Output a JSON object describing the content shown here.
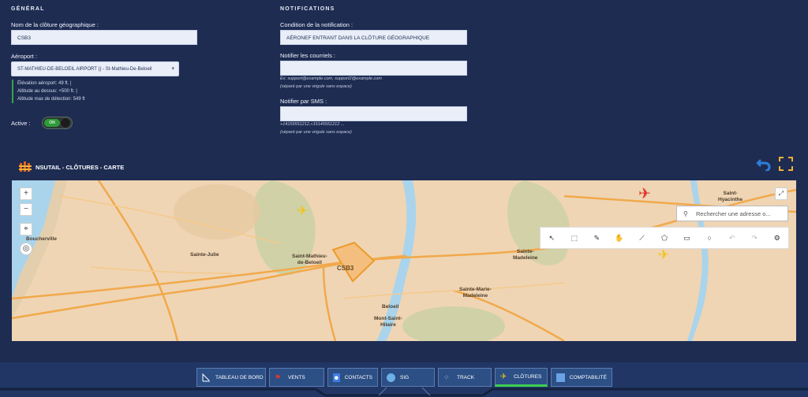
{
  "general": {
    "title": "GÉNÉRAL",
    "name_label": "Nom de la clôture géographique :",
    "name_value": "CSB3",
    "airport_label": "Aéroport :",
    "airport_value": "ST-MATHIEU-DE-BELOEIL AIRPORT () - St-Mathieu-De-Beloeil",
    "elevation": "Élévation aéroport: 49 ft. |",
    "altitude_above": "Altitude au dessus: +500 ft. |",
    "altitude_max": "Altitude max de détection: 549 ft",
    "active_label": "Active :",
    "toggle_on": "ON"
  },
  "notifications": {
    "title": "NOTIFICATIONS",
    "condition_label": "Condition de la notification :",
    "condition_value": "AÉRONEF ENTRANT DANS LA CLÔTURE GÉOGRAPHIQUE",
    "email_label": "Notifier les courriels :",
    "email_hint1": "Ex: support@example.com, support2@example.com",
    "email_hint2": "(séparé par une virgule sans espace)",
    "sms_label": "Notifier par SMS :",
    "sms_hint1": "+14155551212,+15145551212 ...",
    "sms_hint2": "(séparé par une virgule sans espace)"
  },
  "map_header": {
    "title": "NSUTAIL - CLÔTURES - CARTE"
  },
  "map": {
    "search_placeholder": "Rechercher une adresse o...",
    "fence_label": "CSB3",
    "places": {
      "saint_julie": "Sainte-Julie",
      "saint_mathieu": "Saint-Mathieu-\nde-Beloeil",
      "beloeil": "Beloeil",
      "mont_saint_hilaire": "Mont-Saint-\nHilaire",
      "sainte_marie": "Sainte-Marie-\nMadeleine",
      "sainte_madeleine": "Sainte-\nMadeleine",
      "saint_hyacinthe": "Saint-\nHyacinthe",
      "boucherville": "Boucherville"
    }
  },
  "nav": {
    "items": [
      {
        "label": "TABLEAU DE BORD"
      },
      {
        "label": "VENTS"
      },
      {
        "label": "CONTACTS"
      },
      {
        "label": "SIG"
      },
      {
        "label": "TRACK"
      },
      {
        "label": "CLÔTURES"
      },
      {
        "label": "COMPTABILITÉ"
      }
    ]
  }
}
